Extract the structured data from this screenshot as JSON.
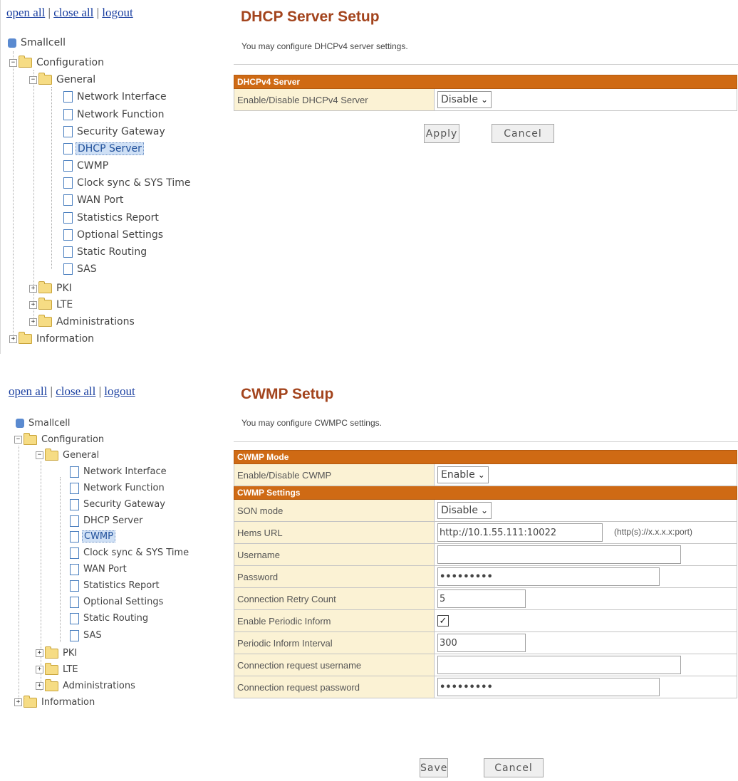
{
  "nav": {
    "open_all": "open all",
    "close_all": "close all",
    "logout": "logout",
    "separator": "|"
  },
  "tree": {
    "root": "Smallcell",
    "configuration": "Configuration",
    "general": "General",
    "general_items": [
      "Network Interface",
      "Network Function",
      "Security Gateway",
      "DHCP Server",
      "CWMP",
      "Clock sync & SYS Time",
      "WAN Port",
      "Statistics Report",
      "Optional Settings",
      "Static Routing",
      "SAS"
    ],
    "pki": "PKI",
    "lte": "LTE",
    "administrations": "Administrations",
    "information": "Information",
    "expander_open": "−",
    "expander_closed": "+"
  },
  "dhcp": {
    "title": "DHCP Server Setup",
    "description": "You may configure DHCPv4 server settings.",
    "section": "DHCPv4 Server",
    "enable_label": "Enable/Disable DHCPv4 Server",
    "enable_value": "Disable",
    "apply": "Apply",
    "cancel": "Cancel",
    "selected_tree_item": "DHCP Server"
  },
  "cwmp": {
    "title": "CWMP Setup",
    "description": "You may configure CWMPC settings.",
    "mode_section": "CWMP Mode",
    "enable_label": "Enable/Disable CWMP",
    "enable_value": "Enable",
    "settings_section": "CWMP Settings",
    "son_label": "SON mode",
    "son_value": "Disable",
    "hems_label": "Hems URL",
    "hems_value": "http://10.1.55.111:10022",
    "hems_hint": "(http(s)://x.x.x.x:port)",
    "username_label": "Username",
    "username_value": "",
    "password_label": "Password",
    "password_value": "•••••••••",
    "retry_label": "Connection Retry Count",
    "retry_value": "5",
    "periodic_label": "Enable Periodic Inform",
    "periodic_checked": true,
    "periodic_mark": "✓",
    "interval_label": "Periodic Inform Interval",
    "interval_value": "300",
    "req_user_label": "Connection request username",
    "req_user_value": "",
    "req_pass_label": "Connection request password",
    "req_pass_value": "•••••••••",
    "save": "Save",
    "cancel": "Cancel",
    "selected_tree_item": "CWMP"
  },
  "colors": {
    "title": "#a3441d",
    "section_header": "#cf6a14",
    "label_bg": "#fbf2d4",
    "link": "#1a3fa0"
  },
  "chevron": "❯"
}
